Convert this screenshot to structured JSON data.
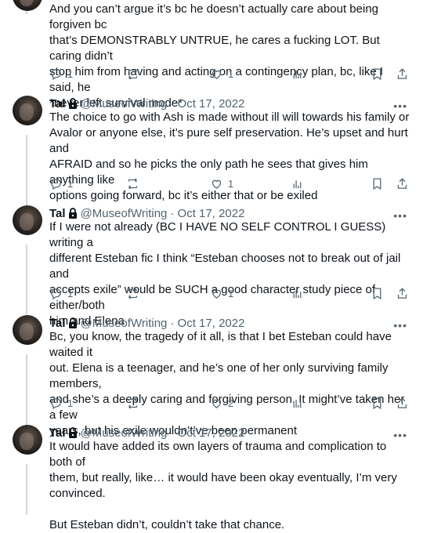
{
  "tweets": [
    {
      "name": "",
      "handle": "",
      "date": "",
      "text": "And you can’t argue it’s bc he doesn’t actually care about being forgiven bc\nthat’s DEMONSTRABLY UNTRUE, he cares a fucking LOT. But caring didn’t\nstop him from having and acting on a contingency plan, bc, like I said, he\n*never left survival mode*",
      "replies": "1",
      "retweets": "",
      "likes": "1"
    },
    {
      "name": "Tal",
      "handle": "@MuseofWriting",
      "date": "· Oct 17, 2022",
      "text": "The choice to go with Ash is made without ill will towards his family or\nAvalor or anyone else, it’s pure self preservation. He’s upset and hurt and\nAFRAID and so he picks the only path he sees that gives him anything like\noptions going forward, bc it’s either that or be exiled",
      "replies": "1",
      "retweets": "",
      "likes": "1"
    },
    {
      "name": "Tal",
      "handle": "@MuseofWriting",
      "date": "· Oct 17, 2022",
      "text": "If I were not already (BC I HAVE NO SELF CONTROL I GUESS) writing a\ndifferent Esteban fic I think “Esteban chooses not to break out of jail and\naccepts exile” would be SUCH a good character study piece of either/both\nhim and Elena",
      "replies": "1",
      "retweets": "",
      "likes": "1"
    },
    {
      "name": "Tal",
      "handle": "@MuseofWriting",
      "date": "· Oct 17, 2022",
      "text": "Bc, you know, the tragedy of it all, is that I bet Esteban could have waited it\nout. Elena is a teenager, and he’s one of her only surviving family members,\nand she’s a deeply caring and forgiving person. It might’ve taken her a few\nyears, but his exile wouldn’t’ve been permanent",
      "replies": "1",
      "retweets": "",
      "likes": "2"
    },
    {
      "name": "Tal",
      "handle": "@MuseofWriting",
      "date": "· Oct 17, 2022",
      "text": "It would have added its own layers of trauma and complication to both of\nthem, but really, like… it would have been okay eventually, I’m very\nconvinced.\n\nBut Esteban didn’t, couldn’t take that chance.",
      "replies": "",
      "retweets": "",
      "likes": ""
    }
  ],
  "icons": {
    "reply": "reply-icon",
    "retweet": "retweet-icon",
    "like": "like-icon",
    "views": "views-icon",
    "bookmark": "bookmark-icon",
    "share": "share-icon",
    "lock": "lock-icon",
    "more": "more-icon"
  },
  "colors": {
    "text": "#0f1419",
    "muted": "#536471",
    "thread_line": "#cfd9de"
  }
}
